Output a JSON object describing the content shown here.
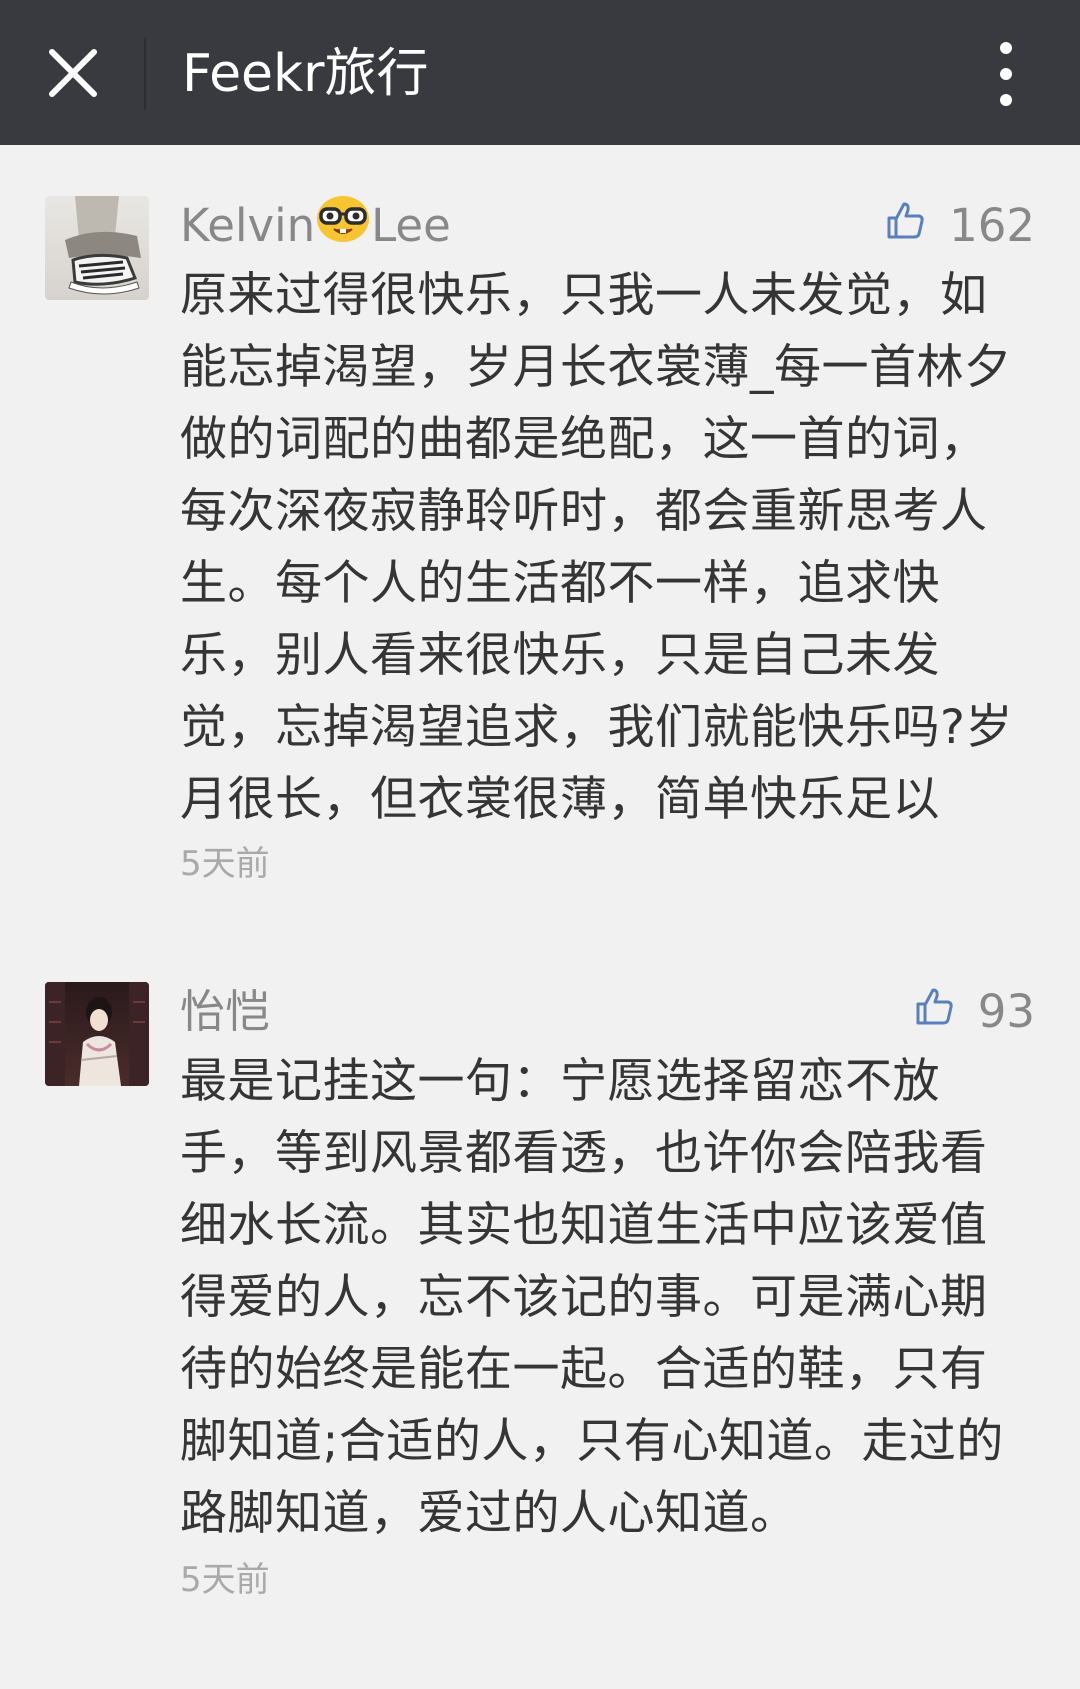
{
  "header": {
    "title": "Feekr旅行",
    "close_icon": "close-icon",
    "more_icon": "more-vertical-icon",
    "bg_color": "#393a3f"
  },
  "comments": [
    {
      "user_name_part1": "Kelvin",
      "user_emoji": "nerd-face-emoji",
      "user_name_part2": "Lee",
      "likes": "162",
      "content": "原来过得很快乐，只我一人未发觉，如能忘掉渴望，岁月长衣裳薄_每一首林夕做的词配的曲都是绝配，这一首的词，每次深夜寂静聆听时，都会重新思考人生。每个人的生活都不一样，追求快乐，别人看来很快乐，只是自己未发觉，忘掉渴望追求，我们就能快乐吗?岁月很长，但衣裳很薄，简单快乐足以",
      "time": "5天前"
    },
    {
      "user_name": "怡恺",
      "likes": "93",
      "content": "最是记挂这一句：宁愿选择留恋不放手，等到风景都看透，也许你会陪我看细水长流。其实也知道生活中应该爱值得爱的人，忘不该记的事。可是满心期待的始终是能在一起。合适的鞋，只有脚知道;合适的人，只有心知道。走过的路脚知道，爱过的人心知道。",
      "time": "5天前"
    }
  ]
}
